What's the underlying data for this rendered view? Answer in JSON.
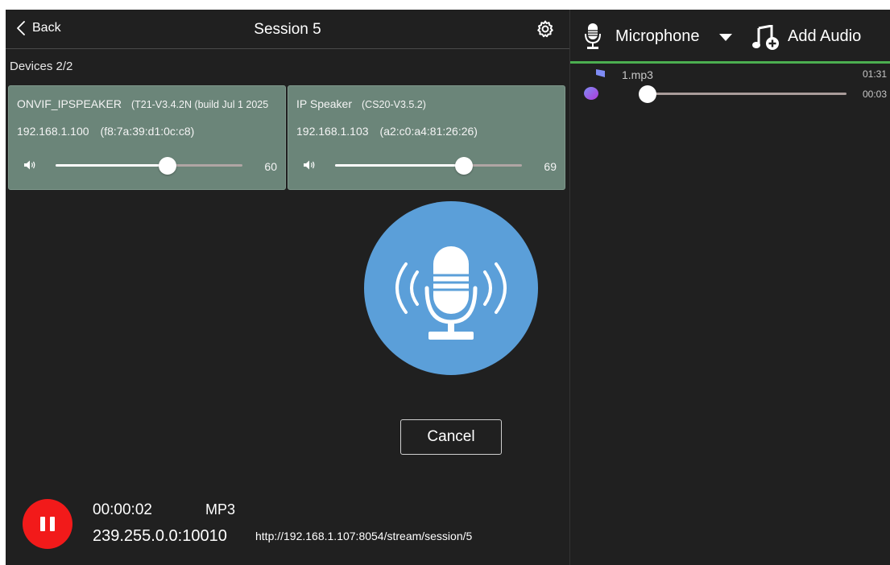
{
  "header": {
    "back_label": "Back",
    "title": "Session 5"
  },
  "devices": {
    "label": "Devices 2/2",
    "items": [
      {
        "name": "ONVIF_IPSPEAKER",
        "version": "(T21-V3.4.2N (build Jul  1 2025",
        "ip": "192.168.1.100",
        "mac": "(f8:7a:39:d1:0c:c8)",
        "volume": "60",
        "volume_fraction": 0.6
      },
      {
        "name": "IP Speaker",
        "version": "(CS20-V3.5.2)",
        "ip": "192.168.1.103",
        "mac": "(a2:c0:a4:81:26:26)",
        "volume": "69",
        "volume_fraction": 0.69
      }
    ]
  },
  "cancel_label": "Cancel",
  "status": {
    "elapsed": "00:00:02",
    "format": "MP3",
    "address": "239.255.0.0:10010",
    "url": "http://192.168.1.107:8054/stream/session/5"
  },
  "source": {
    "label": "Microphone",
    "add_audio_label": "Add Audio"
  },
  "playlist": [
    {
      "name": "1.mp3",
      "total": "01:31",
      "current": "00:03",
      "progress_fraction": 0.033
    }
  ],
  "colors": {
    "background": "#202020",
    "card": "#6b8579",
    "mic_button": "#5b9fd9",
    "pause_button": "#f21a1a",
    "accent_line": "#4caf50"
  },
  "icons": {
    "back": "chevron-left-icon",
    "settings": "gear-icon",
    "volume": "speaker-icon",
    "mic_large": "microphone-broadcast-icon",
    "pause": "pause-icon",
    "mic_small": "microphone-icon",
    "dropdown": "caret-down-icon",
    "add_audio": "music-note-add-icon",
    "track": "music-note-icon"
  }
}
